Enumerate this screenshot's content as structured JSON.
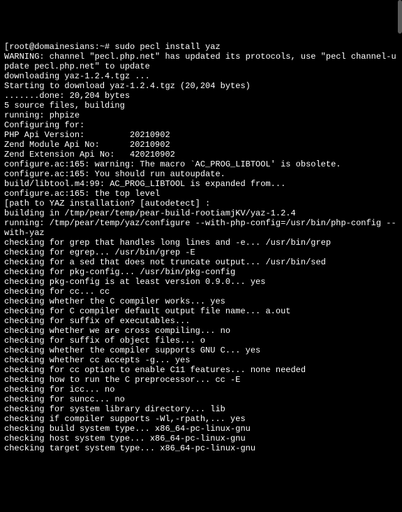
{
  "terminal": {
    "lines": [
      "[root@domainesians:~# sudo pecl install yaz",
      "WARNING: channel \"pecl.php.net\" has updated its protocols, use \"pecl channel-update pecl.php.net\" to update",
      "downloading yaz-1.2.4.tgz ...",
      "Starting to download yaz-1.2.4.tgz (20,204 bytes)",
      ".......done: 20,204 bytes",
      "5 source files, building",
      "running: phpize",
      "Configuring for:",
      "PHP Api Version:         20210902",
      "Zend Module Api No:      20210902",
      "Zend Extension Api No:   420210902",
      "configure.ac:165: warning: The macro `AC_PROG_LIBTOOL' is obsolete.",
      "configure.ac:165: You should run autoupdate.",
      "build/libtool.m4:99: AC_PROG_LIBTOOL is expanded from...",
      "configure.ac:165: the top level",
      "[path to YAZ installation? [autodetect] :",
      "building in /tmp/pear/temp/pear-build-rootiamjKV/yaz-1.2.4",
      "running: /tmp/pear/temp/yaz/configure --with-php-config=/usr/bin/php-config --with-yaz",
      "checking for grep that handles long lines and -e... /usr/bin/grep",
      "checking for egrep... /usr/bin/grep -E",
      "checking for a sed that does not truncate output... /usr/bin/sed",
      "checking for pkg-config... /usr/bin/pkg-config",
      "checking pkg-config is at least version 0.9.0... yes",
      "checking for cc... cc",
      "checking whether the C compiler works... yes",
      "checking for C compiler default output file name... a.out",
      "checking for suffix of executables...",
      "checking whether we are cross compiling... no",
      "checking for suffix of object files... o",
      "checking whether the compiler supports GNU C... yes",
      "checking whether cc accepts -g... yes",
      "checking for cc option to enable C11 features... none needed",
      "checking how to run the C preprocessor... cc -E",
      "checking for icc... no",
      "checking for suncc... no",
      "checking for system library directory... lib",
      "checking if compiler supports -Wl,-rpath,... yes",
      "checking build system type... x86_64-pc-linux-gnu",
      "checking host system type... x86_64-pc-linux-gnu",
      "checking target system type... x86_64-pc-linux-gnu"
    ]
  }
}
